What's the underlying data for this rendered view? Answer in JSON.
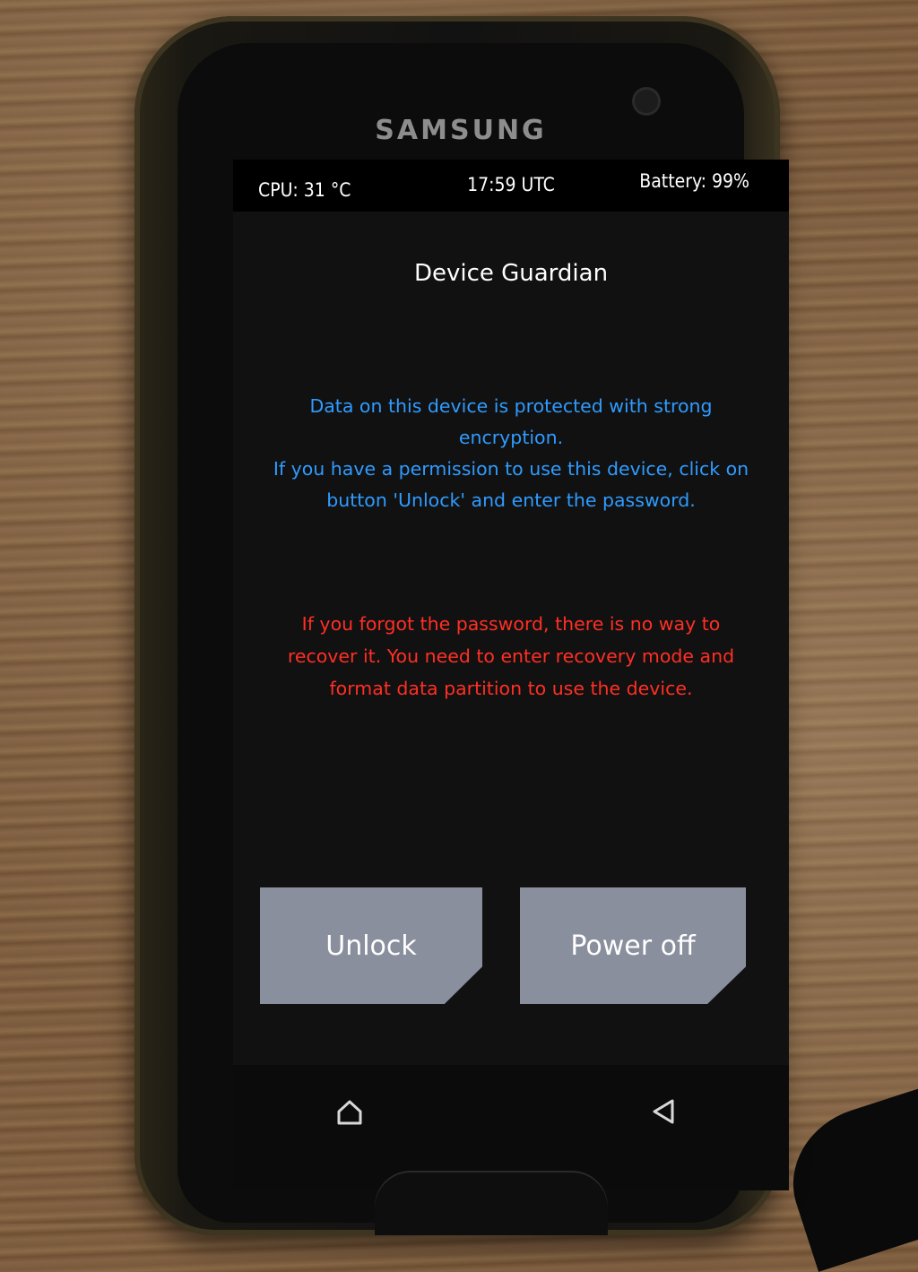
{
  "device": {
    "brand": "SAMSUNG"
  },
  "statusbar": {
    "cpu": "CPU: 31 °C",
    "time": "17:59 UTC",
    "battery": "Battery: 99%"
  },
  "screen": {
    "title": "Device Guardian",
    "info_lines": [
      "Data on this device is protected with strong encryption.",
      "If you have a permission to use this device, click on",
      "button 'Unlock' and enter the password."
    ],
    "warning_lines": [
      "If you forgot the password, there is no way to",
      "recover it. You need to enter recovery mode and",
      "format data partition to use the device."
    ]
  },
  "buttons": {
    "unlock": "Unlock",
    "power_off": "Power off"
  },
  "colors": {
    "info": "#2f9bff",
    "warning": "#ff2f24",
    "button": "#8a8f9e"
  },
  "icons": {
    "home": "home-icon",
    "back": "back-icon"
  }
}
